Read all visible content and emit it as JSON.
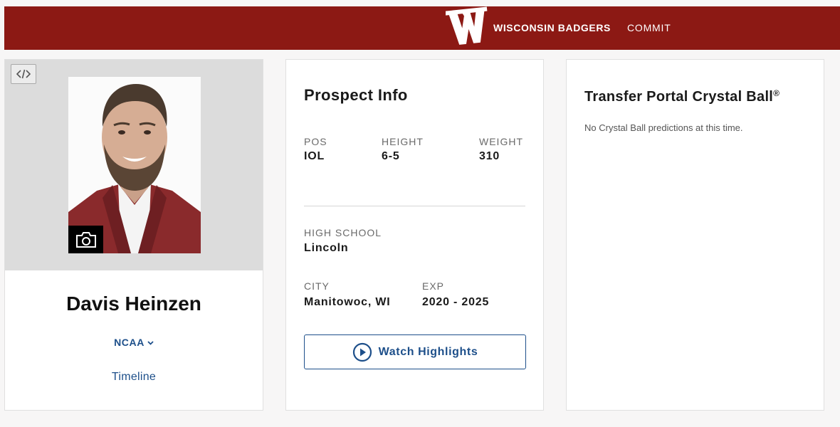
{
  "header": {
    "team_name": "WISCONSIN BADGERS",
    "status": "COMMIT",
    "brand_color": "#8c1914"
  },
  "profile": {
    "name": "Davis Heinzen",
    "league": "NCAA",
    "timeline_link": "Timeline",
    "icons": [
      "code-embed-icon",
      "camera-icon",
      "chevron-down-icon"
    ]
  },
  "prospect_info": {
    "title": "Prospect Info",
    "pos": {
      "label": "POS",
      "value": "IOL"
    },
    "height": {
      "label": "HEIGHT",
      "value": "6-5"
    },
    "weight": {
      "label": "WEIGHT",
      "value": "310"
    },
    "high_school": {
      "label": "HIGH SCHOOL",
      "value": "Lincoln"
    },
    "city": {
      "label": "CITY",
      "value": "Manitowoc, WI"
    },
    "exp": {
      "label": "EXP",
      "value": "2020 - 2025"
    },
    "watch_button": "Watch Highlights",
    "accent_color": "#1d4f8a"
  },
  "crystal_ball": {
    "title": "Transfer Portal Crystal Ball",
    "registered_mark": "®",
    "empty_message": "No Crystal Ball predictions at this time."
  }
}
